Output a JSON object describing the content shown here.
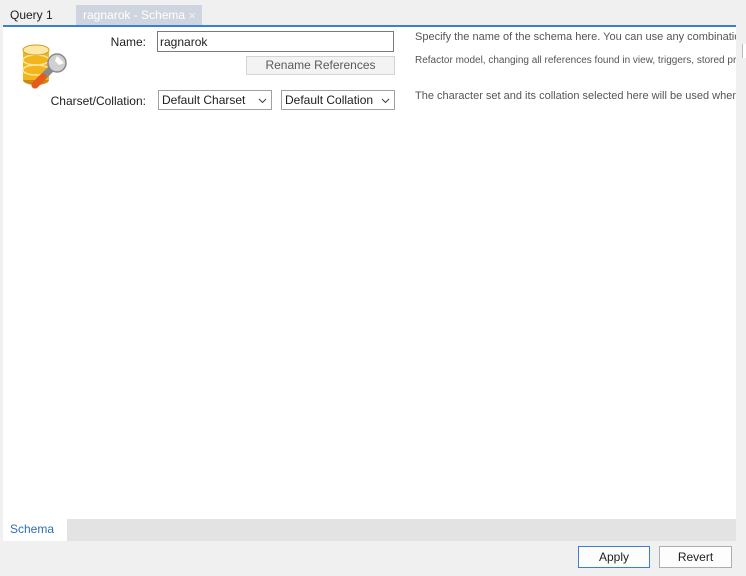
{
  "tabs": {
    "query_label": "Query 1",
    "schema_label": "ragnarok - Schema",
    "close_glyph": "×"
  },
  "form": {
    "name_label": "Name:",
    "name_value": "ragnarok",
    "rename_button": "Rename References",
    "charset_label": "Charset/Collation:",
    "charset_selected": "Default Charset",
    "collation_selected": "Default Collation"
  },
  "help": {
    "name_text": "Specify the name of the schema here. You can use any combination of ANSI",
    "refactor_text": "Refactor model, changing all references found in view, triggers, stored procedures",
    "charset_text": "The character set and its collation selected here will be used when no other"
  },
  "bottom_tabs": {
    "schema_label": "Schema"
  },
  "actions": {
    "apply_label": "Apply",
    "revert_label": "Revert"
  },
  "icons": {
    "schema": "database-wrench-icon",
    "dropdown": "chevron-down-icon",
    "close": "close-icon"
  },
  "colors": {
    "accent": "#3a7fd5",
    "active_tab_bg": "#cfd5de",
    "bottom_tab_text": "#2f6db4"
  }
}
